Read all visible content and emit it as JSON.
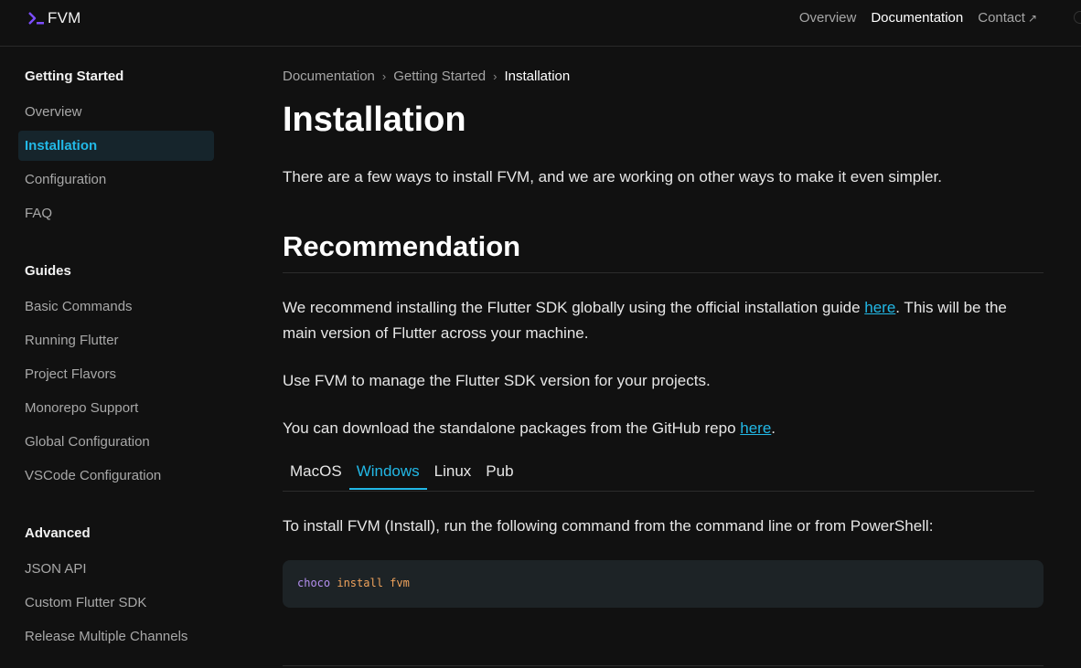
{
  "brand": {
    "name": "FVM",
    "icon": "terminal-prompt-icon",
    "accent": "#7c4dff"
  },
  "topnav": {
    "items": [
      {
        "label": "Overview",
        "active": false
      },
      {
        "label": "Documentation",
        "active": true
      },
      {
        "label": "Contact",
        "active": false
      }
    ],
    "external_icon": "↗"
  },
  "sidebar": {
    "sections": [
      {
        "title": "Getting Started",
        "items": [
          {
            "label": "Overview",
            "active": false
          },
          {
            "label": "Installation",
            "active": true
          },
          {
            "label": "Configuration",
            "active": false
          },
          {
            "label": "FAQ",
            "active": false
          }
        ]
      },
      {
        "title": "Guides",
        "items": [
          {
            "label": "Basic Commands",
            "active": false
          },
          {
            "label": "Running Flutter",
            "active": false
          },
          {
            "label": "Project Flavors",
            "active": false
          },
          {
            "label": "Monorepo Support",
            "active": false
          },
          {
            "label": "Global Configuration",
            "active": false
          },
          {
            "label": "VSCode Configuration",
            "active": false
          }
        ]
      },
      {
        "title": "Advanced",
        "items": [
          {
            "label": "JSON API",
            "active": false
          },
          {
            "label": "Custom Flutter SDK",
            "active": false
          },
          {
            "label": "Release Multiple Channels",
            "active": false
          }
        ]
      }
    ]
  },
  "breadcrumb": {
    "items": [
      "Documentation",
      "Getting Started"
    ],
    "current": "Installation",
    "separator": "›"
  },
  "page": {
    "title": "Installation",
    "intro": "There are a few ways to install FVM, and we are working on other ways to make it even simpler.",
    "section_title": "Recommendation",
    "rec_p1_before": "We recommend installing the Flutter SDK globally using the official installation guide ",
    "rec_p1_link": "here",
    "rec_p1_after_line1": ". This will be the",
    "rec_p1_line2": "main version of Flutter across your machine.",
    "rec_p2": "Use FVM to manage the Flutter SDK version for your projects.",
    "rec_p3_before": "You can download the standalone packages from the GitHub repo ",
    "rec_p3_link": "here",
    "rec_p3_after": "."
  },
  "tabs": [
    {
      "label": "MacOS",
      "active": false
    },
    {
      "label": "Windows",
      "active": true
    },
    {
      "label": "Linux",
      "active": false
    },
    {
      "label": "Pub",
      "active": false
    }
  ],
  "install_instruction": "To install FVM (Install), run the following command from the command line or from PowerShell:",
  "code": {
    "command": "choco",
    "args": "install fvm"
  },
  "colors": {
    "accent": "#22b8e6",
    "background": "#111111",
    "code_bg": "#1d2326"
  }
}
